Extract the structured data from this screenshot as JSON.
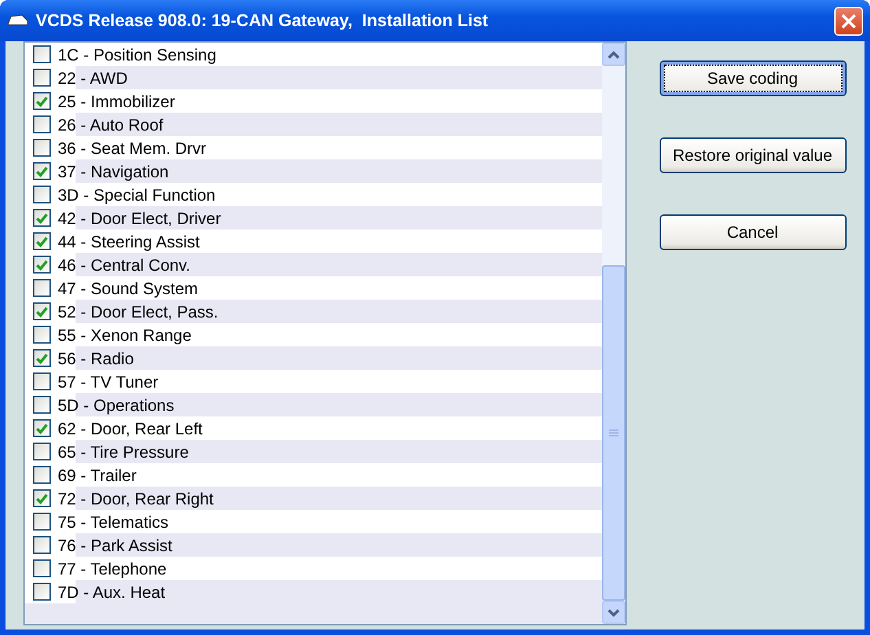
{
  "window": {
    "title": "VCDS Release 908.0: 19-CAN Gateway,  Installation List"
  },
  "items": [
    {
      "label": "1C - Position Sensing",
      "checked": false
    },
    {
      "label": "22 - AWD",
      "checked": false
    },
    {
      "label": "25 - Immobilizer",
      "checked": true
    },
    {
      "label": "26 - Auto Roof",
      "checked": false
    },
    {
      "label": "36 - Seat Mem. Drvr",
      "checked": false
    },
    {
      "label": "37 - Navigation",
      "checked": true
    },
    {
      "label": "3D - Special Function",
      "checked": false
    },
    {
      "label": "42 - Door Elect, Driver",
      "checked": true
    },
    {
      "label": "44 - Steering Assist",
      "checked": true
    },
    {
      "label": "46 - Central Conv.",
      "checked": true
    },
    {
      "label": "47 - Sound System",
      "checked": false
    },
    {
      "label": "52 - Door Elect, Pass.",
      "checked": true
    },
    {
      "label": "55 - Xenon Range",
      "checked": false
    },
    {
      "label": "56 - Radio",
      "checked": true
    },
    {
      "label": "57 - TV Tuner",
      "checked": false
    },
    {
      "label": "5D - Operations",
      "checked": false
    },
    {
      "label": "62 - Door, Rear Left",
      "checked": true
    },
    {
      "label": "65 - Tire Pressure",
      "checked": false
    },
    {
      "label": "69 - Trailer",
      "checked": false
    },
    {
      "label": "72 - Door, Rear Right",
      "checked": true
    },
    {
      "label": "75 - Telematics",
      "checked": false
    },
    {
      "label": "76 - Park Assist",
      "checked": false
    },
    {
      "label": "77 - Telephone",
      "checked": false
    },
    {
      "label": "7D - Aux. Heat",
      "checked": false
    }
  ],
  "buttons": [
    {
      "label": "Save coding",
      "focused": true
    },
    {
      "label": "Restore original value",
      "focused": false
    },
    {
      "label": "Cancel",
      "focused": false
    }
  ]
}
